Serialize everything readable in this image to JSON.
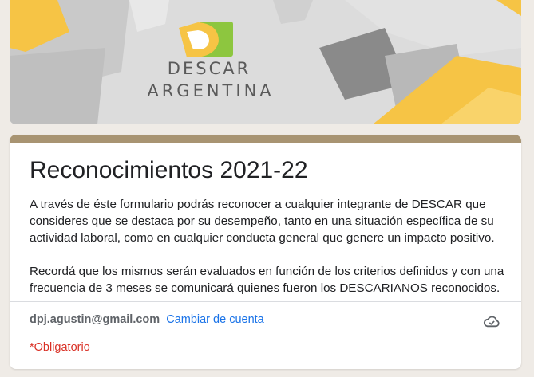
{
  "header": {
    "brand_line1": "DESCAR",
    "brand_line2": "ARGENTINA"
  },
  "form": {
    "title": "Reconocimientos 2021-22",
    "description": [
      "A través de éste formulario podrás reconocer a cualquier integrante de DESCAR que consideres que se destaca por su desempeño, tanto en una situación específica de su actividad laboral, como en cualquier conducta general que genere un impacto positivo.",
      "Recordá que los mismos serán evaluados en función de los criterios definidos y con una frecuencia de 3 meses se comunicará quienes fueron los DESCARIANOS reconocidos."
    ],
    "account_email": "dpj.agustin@gmail.com",
    "switch_account_label": "Cambiar de cuenta",
    "required_note": "*Obligatorio",
    "cloud_icon": "cloud-saved-icon"
  },
  "colors": {
    "accent": "#a89472",
    "link": "#1a73e8",
    "required": "#d93025",
    "logo_yellow": "#f6c445",
    "logo_green": "#8dc63f"
  }
}
